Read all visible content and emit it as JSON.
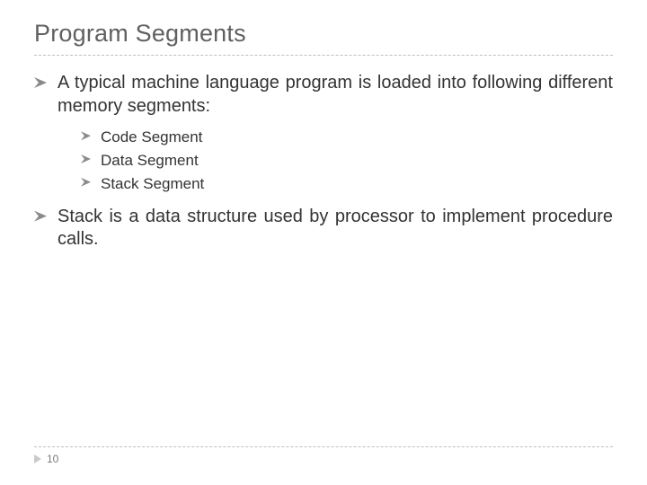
{
  "title": "Program Segments",
  "bullets": [
    {
      "text": "A typical machine language program is loaded into following different memory segments:",
      "sub": [
        "Code Segment",
        "Data Segment",
        "Stack Segment"
      ]
    },
    {
      "text": "Stack is a data structure used by processor to implement procedure calls."
    }
  ],
  "page_number": "10"
}
